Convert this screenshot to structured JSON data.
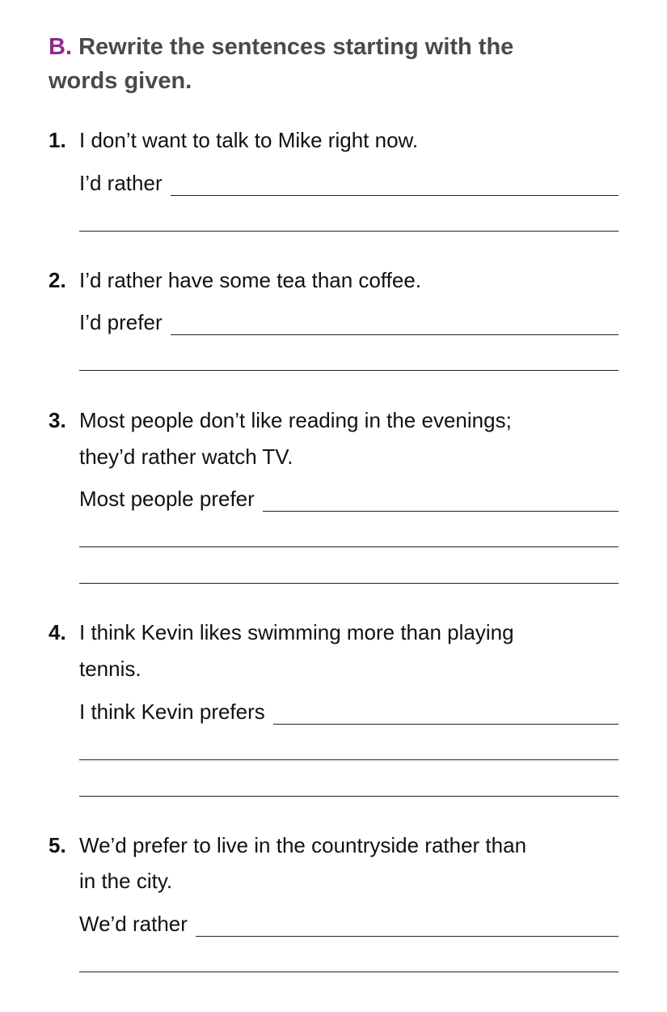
{
  "header": {
    "letter": "B",
    "dot": ".",
    "line1": "Rewrite the sentences starting with the",
    "line2": "words given."
  },
  "items": [
    {
      "num": "1.",
      "lines": [
        "I don’t want to talk to Mike right now."
      ],
      "prefix": "I’d rather"
    },
    {
      "num": "2.",
      "lines": [
        "I’d rather have some tea than coffee."
      ],
      "prefix": "I’d prefer"
    },
    {
      "num": "3.",
      "lines": [
        "Most people don’t like reading in the evenings;",
        "they’d rather watch TV."
      ],
      "prefix": "Most people prefer"
    },
    {
      "num": "4.",
      "lines": [
        "I think Kevin likes swimming more than playing",
        "tennis."
      ],
      "prefix": "I think Kevin prefers"
    },
    {
      "num": "5.",
      "lines": [
        "We’d prefer to live in the countryside rather than",
        "in the city."
      ],
      "prefix": "We’d rather"
    }
  ],
  "colors": {
    "accent": "#8e2a8f",
    "heading": "#4a4a4a"
  }
}
